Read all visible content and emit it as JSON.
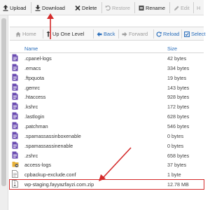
{
  "toolbar": {
    "upload_label": "Upload",
    "download_label": "Download",
    "delete_label": "Delete",
    "restore_label": "Restore",
    "rename_label": "Rename",
    "edit_label": "Edit",
    "more_label": "H"
  },
  "nav": {
    "home_label": "Home",
    "up_label": "Up One Level",
    "back_label": "Back",
    "forward_label": "Forward",
    "reload_label": "Reload",
    "select_label": "Select"
  },
  "table": {
    "columns": {
      "name": "Name",
      "size": "Size"
    },
    "rows": [
      {
        "name": ".cpanel-logs",
        "size": "42 bytes",
        "icon": "document-icon"
      },
      {
        "name": ".emacs",
        "size": "334 bytes",
        "icon": "document-icon"
      },
      {
        "name": ".ftpquota",
        "size": "19 bytes",
        "icon": "document-icon"
      },
      {
        "name": ".gemrc",
        "size": "143 bytes",
        "icon": "document-icon"
      },
      {
        "name": ".htaccess",
        "size": "928 bytes",
        "icon": "document-icon"
      },
      {
        "name": ".kshrc",
        "size": "172 bytes",
        "icon": "document-icon"
      },
      {
        "name": ".lastlogin",
        "size": "628 bytes",
        "icon": "document-icon"
      },
      {
        "name": ".patchman",
        "size": "546 bytes",
        "icon": "document-icon"
      },
      {
        "name": ".spamassassinboxenable",
        "size": "0 bytes",
        "icon": "document-icon"
      },
      {
        "name": ".spamassassinenable",
        "size": "0 bytes",
        "icon": "document-icon"
      },
      {
        "name": ".zshrc",
        "size": "658 bytes",
        "icon": "document-icon"
      },
      {
        "name": "access-logs",
        "size": "37 bytes",
        "icon": "folder-link-icon"
      },
      {
        "name": "cpbackup-exclude.conf",
        "size": "1 byte",
        "icon": "text-file-icon"
      },
      {
        "name": "wp-staging.fayyazfayzi.com.zip",
        "size": "12.78 MB",
        "icon": "zip-file-icon"
      }
    ]
  },
  "colors": {
    "accent_link": "#2a6ebb",
    "file_icon": "#6a4bb0",
    "highlight": "#d42a2a"
  }
}
